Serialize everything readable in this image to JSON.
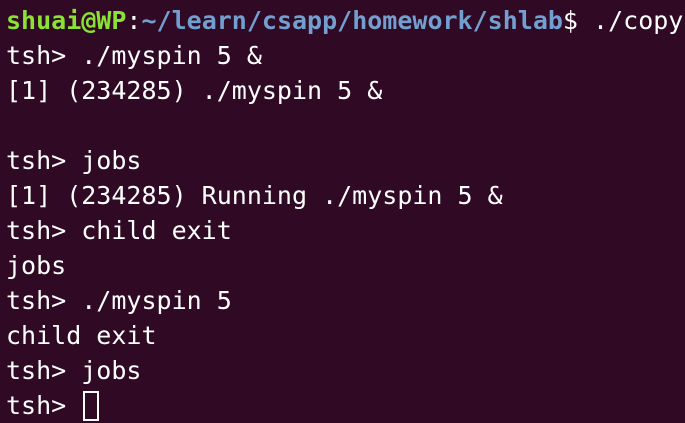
{
  "prompt": {
    "user_host": "shuai@WP",
    "separator": ":",
    "path": "~/learn/csapp/homework/shlab",
    "symbol": "$",
    "command": " ./copy"
  },
  "lines": [
    "tsh> ./myspin 5 &",
    "[1] (234285) ./myspin 5 &",
    "",
    "tsh> jobs",
    "[1] (234285) Running ./myspin 5 &",
    "tsh> child exit",
    "jobs",
    "tsh> ./myspin 5",
    "child exit",
    "tsh> jobs"
  ],
  "current_prompt": "tsh> ",
  "colors": {
    "background": "#300a24",
    "user_host": "#8ae234",
    "path": "#729fcf",
    "text": "#ffffff"
  }
}
